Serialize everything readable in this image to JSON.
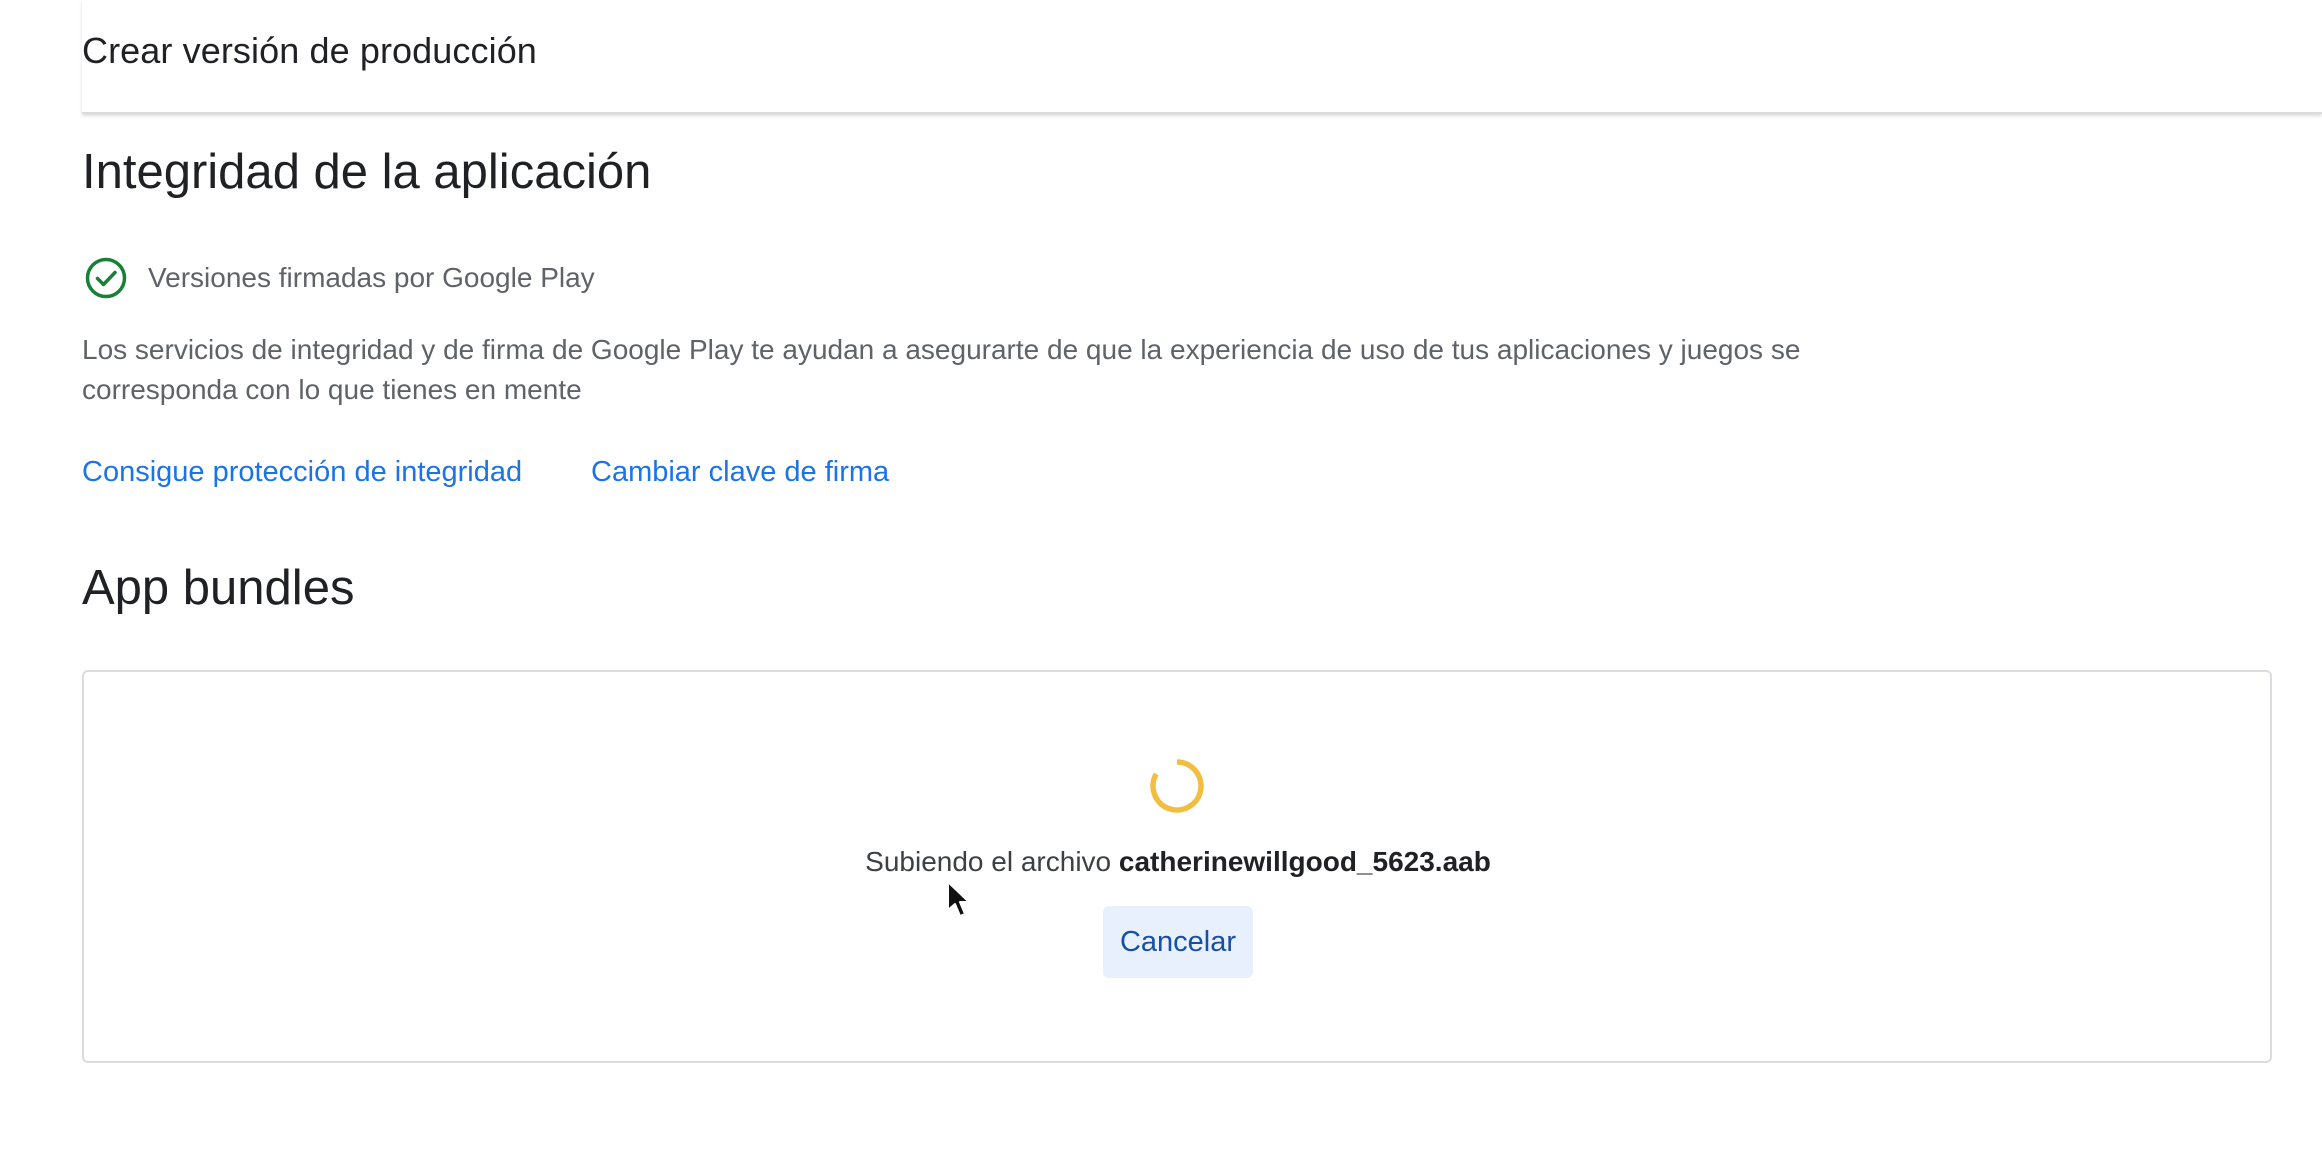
{
  "header": {
    "title": "Crear versión de producción"
  },
  "integrity": {
    "title": "Integridad de la aplicación",
    "signed_icon": "check-circle-icon",
    "signed_label": "Versiones firmadas por Google Play",
    "description_line1": "Los servicios de integridad y de firma de Google Play te ayudan a asegurarte de que la experiencia de uso de tus aplicaciones y juegos se",
    "description_line2": "corresponda con lo que tienes en mente",
    "link_integrity": "Consigue protección de integridad",
    "link_signing": "Cambiar clave de firma"
  },
  "bundles": {
    "title": "App bundles",
    "spinner_icon": "loading-spinner-icon",
    "uploading_text": "Subiendo el archivo",
    "filename": "catherinewillgood_5623.aab",
    "cancel_label": "Cancelar"
  },
  "colors": {
    "success": "#188038",
    "link": "#1a73e8",
    "spinner": "#f2be42",
    "cancel_bg": "#e8f0fe",
    "cancel_text": "#174ea6"
  }
}
